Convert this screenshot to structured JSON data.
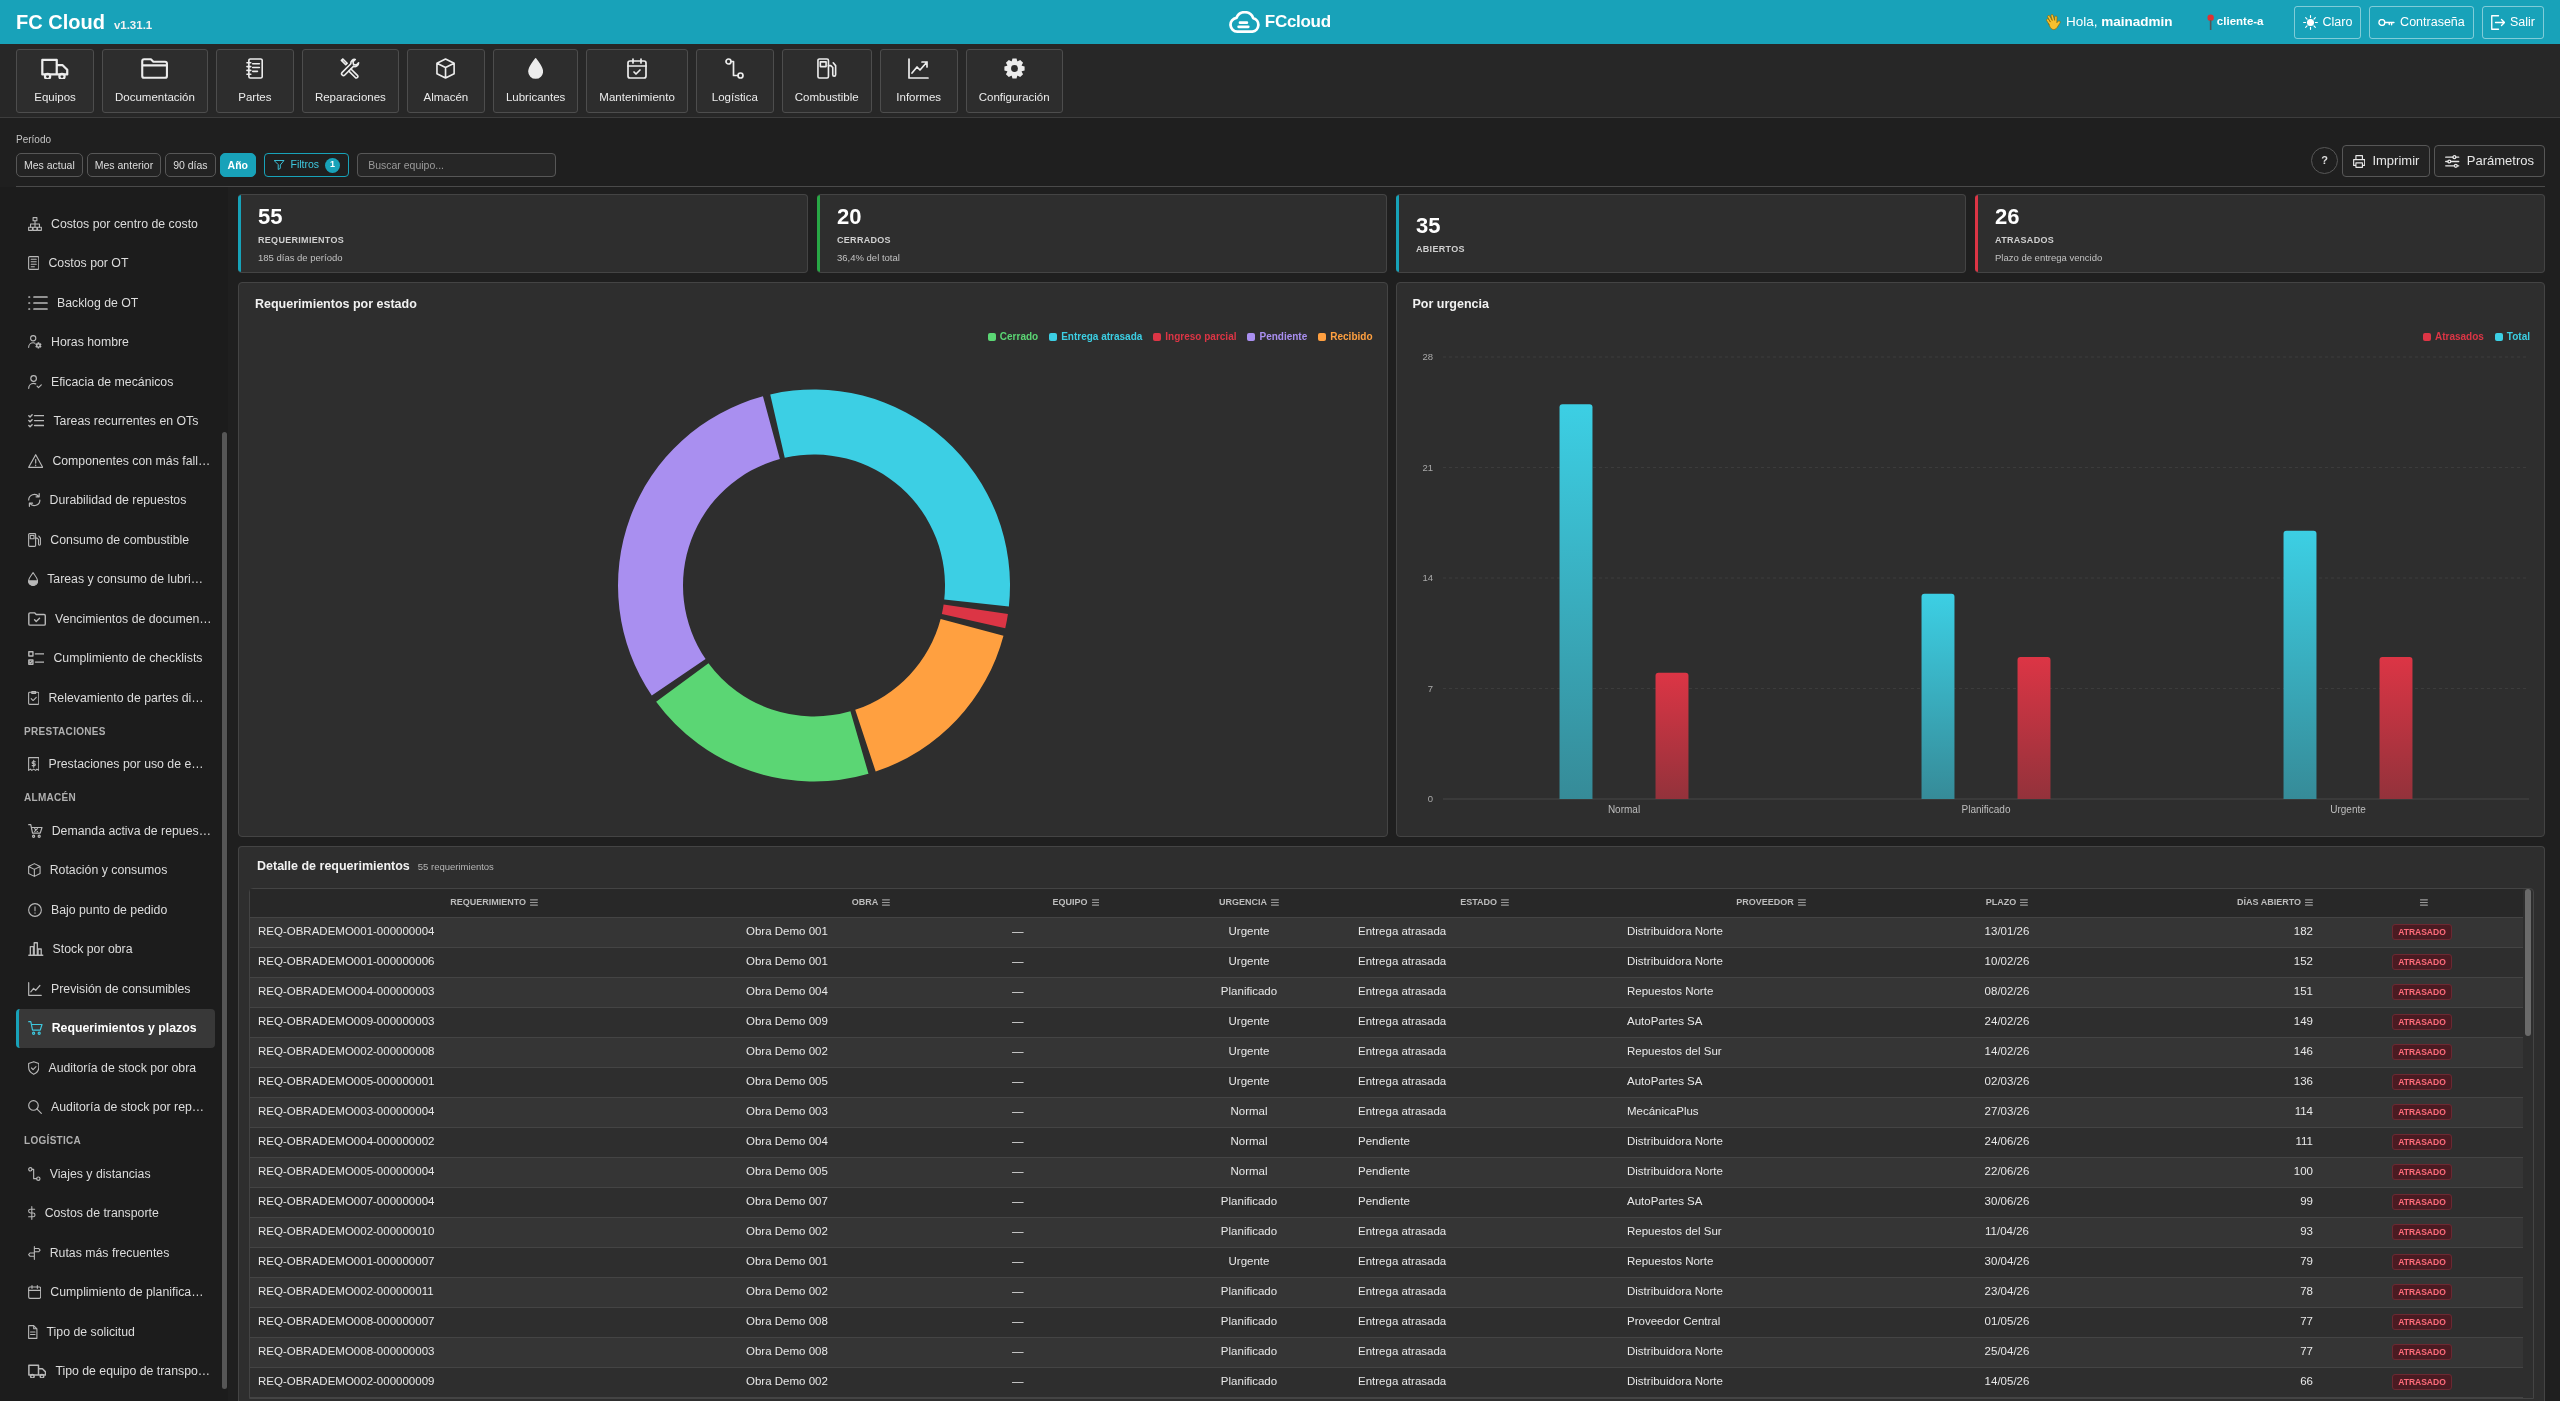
{
  "app": {
    "title": "FC Cloud",
    "version": "v1.31.1",
    "logo_text": "FCcloud"
  },
  "user_bar": {
    "greeting": "Hola, **mainadmin**",
    "tenant": "cliente-a",
    "buttons": [
      "Claro",
      "Contraseña",
      "Salir"
    ]
  },
  "modules": [
    "Equipos",
    "Documentación",
    "Partes",
    "Reparaciones",
    "Almacén",
    "Lubricantes",
    "Mantenimiento",
    "Logística",
    "Combustible",
    "Informes",
    "Configuración"
  ],
  "filters": {
    "period_label": "Período",
    "periods": [
      {
        "label": "Mes actual",
        "selected": false
      },
      {
        "label": "Mes anterior",
        "selected": false
      },
      {
        "label": "90 días",
        "selected": false
      },
      {
        "label": "Año",
        "selected": true
      }
    ],
    "filter_button": {
      "label": "Filtros",
      "count": "1"
    },
    "search": {
      "placeholder": "Buscar equipo..."
    }
  },
  "actions": {
    "help": "?",
    "buttons": [
      "Imprimir",
      "Parámetros"
    ]
  },
  "sidebar": {
    "sections": [
      {
        "items": [
          {
            "label": "Costos por centro de costo",
            "selected": false
          },
          {
            "label": "Costos por OT",
            "selected": false
          },
          {
            "label": "Backlog de OT",
            "selected": false
          },
          {
            "label": "Horas hombre",
            "selected": false
          },
          {
            "label": "Eficacia de mecánicos",
            "selected": false
          },
          {
            "label": "Tareas recurrentes en OTs",
            "selected": false
          },
          {
            "label": "Componentes con más fall…",
            "selected": false
          },
          {
            "label": "Durabilidad de repuestos",
            "selected": false
          },
          {
            "label": "Consumo de combustible",
            "selected": false
          },
          {
            "label": "Tareas y consumo de lubri…",
            "selected": false
          },
          {
            "label": "Vencimientos de documen…",
            "selected": false
          },
          {
            "label": "Cumplimiento de checklists",
            "selected": false
          },
          {
            "label": "Relevamiento de partes di…",
            "selected": false
          }
        ]
      },
      {
        "heading": "PRESTACIONES",
        "items": [
          {
            "label": "Prestaciones por uso de e…",
            "selected": false
          }
        ]
      },
      {
        "heading": "ALMACÉN",
        "items": [
          {
            "label": "Demanda activa de repues…",
            "selected": false
          },
          {
            "label": "Rotación y consumos",
            "selected": false
          },
          {
            "label": "Bajo punto de pedido",
            "selected": false
          },
          {
            "label": "Stock por obra",
            "selected": false
          },
          {
            "label": "Previsión de consumibles",
            "selected": false
          },
          {
            "label": "Requerimientos y plazos",
            "selected": true
          },
          {
            "label": "Auditoría de stock por obra",
            "selected": false
          },
          {
            "label": "Auditoría de stock por rep…",
            "selected": false
          }
        ]
      },
      {
        "heading": "LOGÍSTICA",
        "items": [
          {
            "label": "Viajes y distancias",
            "selected": false
          },
          {
            "label": "Costos de transporte",
            "selected": false
          },
          {
            "label": "Rutas más frecuentes",
            "selected": false
          },
          {
            "label": "Cumplimiento de planifica…",
            "selected": false
          },
          {
            "label": "Tipo de solicitud",
            "selected": false
          },
          {
            "label": "Tipo de equipo de transpo…",
            "selected": false
          }
        ]
      }
    ]
  },
  "kpis": [
    {
      "value": "55",
      "label": "REQUERIMIENTOS",
      "note": "185 días de período",
      "color": "#17a2b8"
    },
    {
      "value": "20",
      "label": "CERRADOS",
      "note": "36,4% del total",
      "color": "#28a745"
    },
    {
      "value": "35",
      "label": "ABIERTOS",
      "color": "#17a2b8"
    },
    {
      "value": "26",
      "label": "ATRASADOS",
      "note": "Plazo de entrega vencido",
      "color": "#dc3545"
    }
  ],
  "status_chart": {
    "chart_data": {
      "type": "donut",
      "title": "Requerimientos por estado",
      "categories": [
        "Entrega atrasada",
        "Ingreso parcial",
        "Recibido",
        "Cerrado",
        "Pendiente"
      ],
      "values": [
        30.9,
        1.8,
        16.4,
        20.0,
        30.9
      ],
      "colors": [
        "#3ccfe4",
        "#dc3545",
        "#ffa040",
        "#5bd674",
        "#a98ff0"
      ]
    }
  },
  "urgency_chart": {
    "chart_data": {
      "type": "bar",
      "title": "Por urgencia",
      "categories": [
        "Normal",
        "Planificado",
        "Urgente"
      ],
      "series": [
        {
          "name": "Total",
          "color": "#3ccfe4",
          "values": [
            25,
            13,
            17
          ]
        },
        {
          "name": "Atrasados",
          "color": "#dc3545",
          "values": [
            8,
            9,
            9
          ]
        }
      ],
      "ylim": [
        0,
        28
      ],
      "yticks": [
        0,
        7,
        14,
        21,
        28
      ],
      "grid": true
    }
  },
  "detail_table": {
    "title": "Detalle de requerimientos",
    "count": "55 requerimientos",
    "columns": [
      "REQUERIMIENTO",
      "OBRA",
      "EQUIPO",
      "URGENCIA",
      "ESTADO",
      "PROVEEDOR",
      "PLAZO",
      "DÍAS ABIERTO"
    ],
    "rows": [
      {
        "cells": [
          "REQ-OBRADEMO001-000000004",
          "Obra Demo 001",
          "—",
          "Urgente",
          "Entrega atrasada",
          "Distribuidora Norte",
          "13/01/26",
          "182"
        ],
        "status": "ATRASADO"
      },
      {
        "cells": [
          "REQ-OBRADEMO001-000000006",
          "Obra Demo 001",
          "—",
          "Urgente",
          "Entrega atrasada",
          "Distribuidora Norte",
          "10/02/26",
          "152"
        ],
        "status": "ATRASADO"
      },
      {
        "cells": [
          "REQ-OBRADEMO004-000000003",
          "Obra Demo 004",
          "—",
          "Planificado",
          "Entrega atrasada",
          "Repuestos Norte",
          "08/02/26",
          "151"
        ],
        "status": "ATRASADO"
      },
      {
        "cells": [
          "REQ-OBRADEMO009-000000003",
          "Obra Demo 009",
          "—",
          "Urgente",
          "Entrega atrasada",
          "AutoPartes SA",
          "24/02/26",
          "149"
        ],
        "status": "ATRASADO"
      },
      {
        "cells": [
          "REQ-OBRADEMO002-000000008",
          "Obra Demo 002",
          "—",
          "Urgente",
          "Entrega atrasada",
          "Repuestos del Sur",
          "14/02/26",
          "146"
        ],
        "status": "ATRASADO"
      },
      {
        "cells": [
          "REQ-OBRADEMO005-000000001",
          "Obra Demo 005",
          "—",
          "Urgente",
          "Entrega atrasada",
          "AutoPartes SA",
          "02/03/26",
          "136"
        ],
        "status": "ATRASADO"
      },
      {
        "cells": [
          "REQ-OBRADEMO003-000000004",
          "Obra Demo 003",
          "—",
          "Normal",
          "Entrega atrasada",
          "MecánicaPlus",
          "27/03/26",
          "114"
        ],
        "status": "ATRASADO"
      },
      {
        "cells": [
          "REQ-OBRADEMO004-000000002",
          "Obra Demo 004",
          "—",
          "Normal",
          "Pendiente",
          "Distribuidora Norte",
          "24/06/26",
          "111"
        ],
        "status": "ATRASADO"
      },
      {
        "cells": [
          "REQ-OBRADEMO005-000000004",
          "Obra Demo 005",
          "—",
          "Normal",
          "Pendiente",
          "Distribuidora Norte",
          "22/06/26",
          "100"
        ],
        "status": "ATRASADO"
      },
      {
        "cells": [
          "REQ-OBRADEMO007-000000004",
          "Obra Demo 007",
          "—",
          "Planificado",
          "Pendiente",
          "AutoPartes SA",
          "30/06/26",
          "99"
        ],
        "status": "ATRASADO"
      },
      {
        "cells": [
          "REQ-OBRADEMO002-000000010",
          "Obra Demo 002",
          "—",
          "Planificado",
          "Entrega atrasada",
          "Repuestos del Sur",
          "11/04/26",
          "93"
        ],
        "status": "ATRASADO"
      },
      {
        "cells": [
          "REQ-OBRADEMO001-000000007",
          "Obra Demo 001",
          "—",
          "Urgente",
          "Entrega atrasada",
          "Repuestos Norte",
          "30/04/26",
          "79"
        ],
        "status": "ATRASADO"
      },
      {
        "cells": [
          "REQ-OBRADEMO002-000000011",
          "Obra Demo 002",
          "—",
          "Planificado",
          "Entrega atrasada",
          "Distribuidora Norte",
          "23/04/26",
          "78"
        ],
        "status": "ATRASADO"
      },
      {
        "cells": [
          "REQ-OBRADEMO008-000000007",
          "Obra Demo 008",
          "—",
          "Planificado",
          "Entrega atrasada",
          "Proveedor Central",
          "01/05/26",
          "77"
        ],
        "status": "ATRASADO"
      },
      {
        "cells": [
          "REQ-OBRADEMO008-000000003",
          "Obra Demo 008",
          "—",
          "Planificado",
          "Entrega atrasada",
          "Distribuidora Norte",
          "25/04/26",
          "77"
        ],
        "status": "ATRASADO"
      },
      {
        "cells": [
          "REQ-OBRADEMO002-000000009",
          "Obra Demo 002",
          "—",
          "Planificado",
          "Entrega atrasada",
          "Distribuidora Norte",
          "14/05/26",
          "66"
        ],
        "status": "ATRASADO"
      }
    ]
  }
}
